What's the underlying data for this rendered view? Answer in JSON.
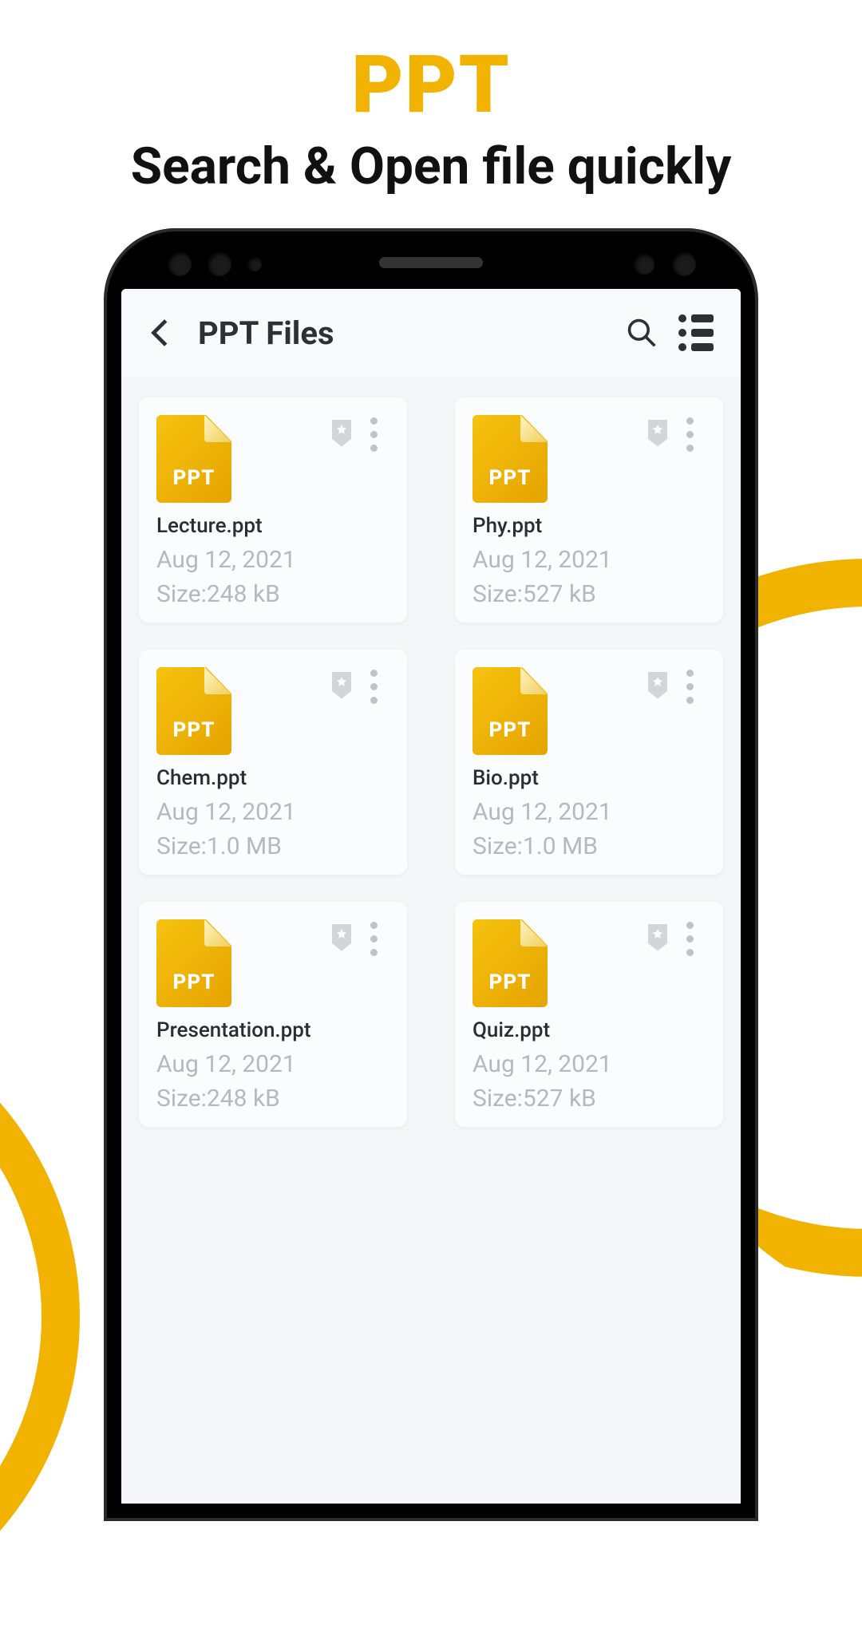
{
  "promo": {
    "title": "PPT",
    "subtitle": "Search & Open file quickly"
  },
  "header": {
    "title": "PPT Files"
  },
  "fileIconLabel": "PPT",
  "sizePrefix": "Size:",
  "files": [
    {
      "name": "Lecture.ppt",
      "date": "Aug 12, 2021",
      "size": "248 kB"
    },
    {
      "name": "Phy.ppt",
      "date": "Aug 12, 2021",
      "size": "527 kB"
    },
    {
      "name": "Chem.ppt",
      "date": "Aug 12, 2021",
      "size": "1.0 MB"
    },
    {
      "name": "Bio.ppt",
      "date": "Aug 12, 2021",
      "size": "1.0 MB"
    },
    {
      "name": "Presentation.ppt",
      "date": "Aug 12, 2021",
      "size": "248 kB"
    },
    {
      "name": "Quiz.ppt",
      "date": "Aug 12, 2021",
      "size": "527 kB"
    }
  ]
}
